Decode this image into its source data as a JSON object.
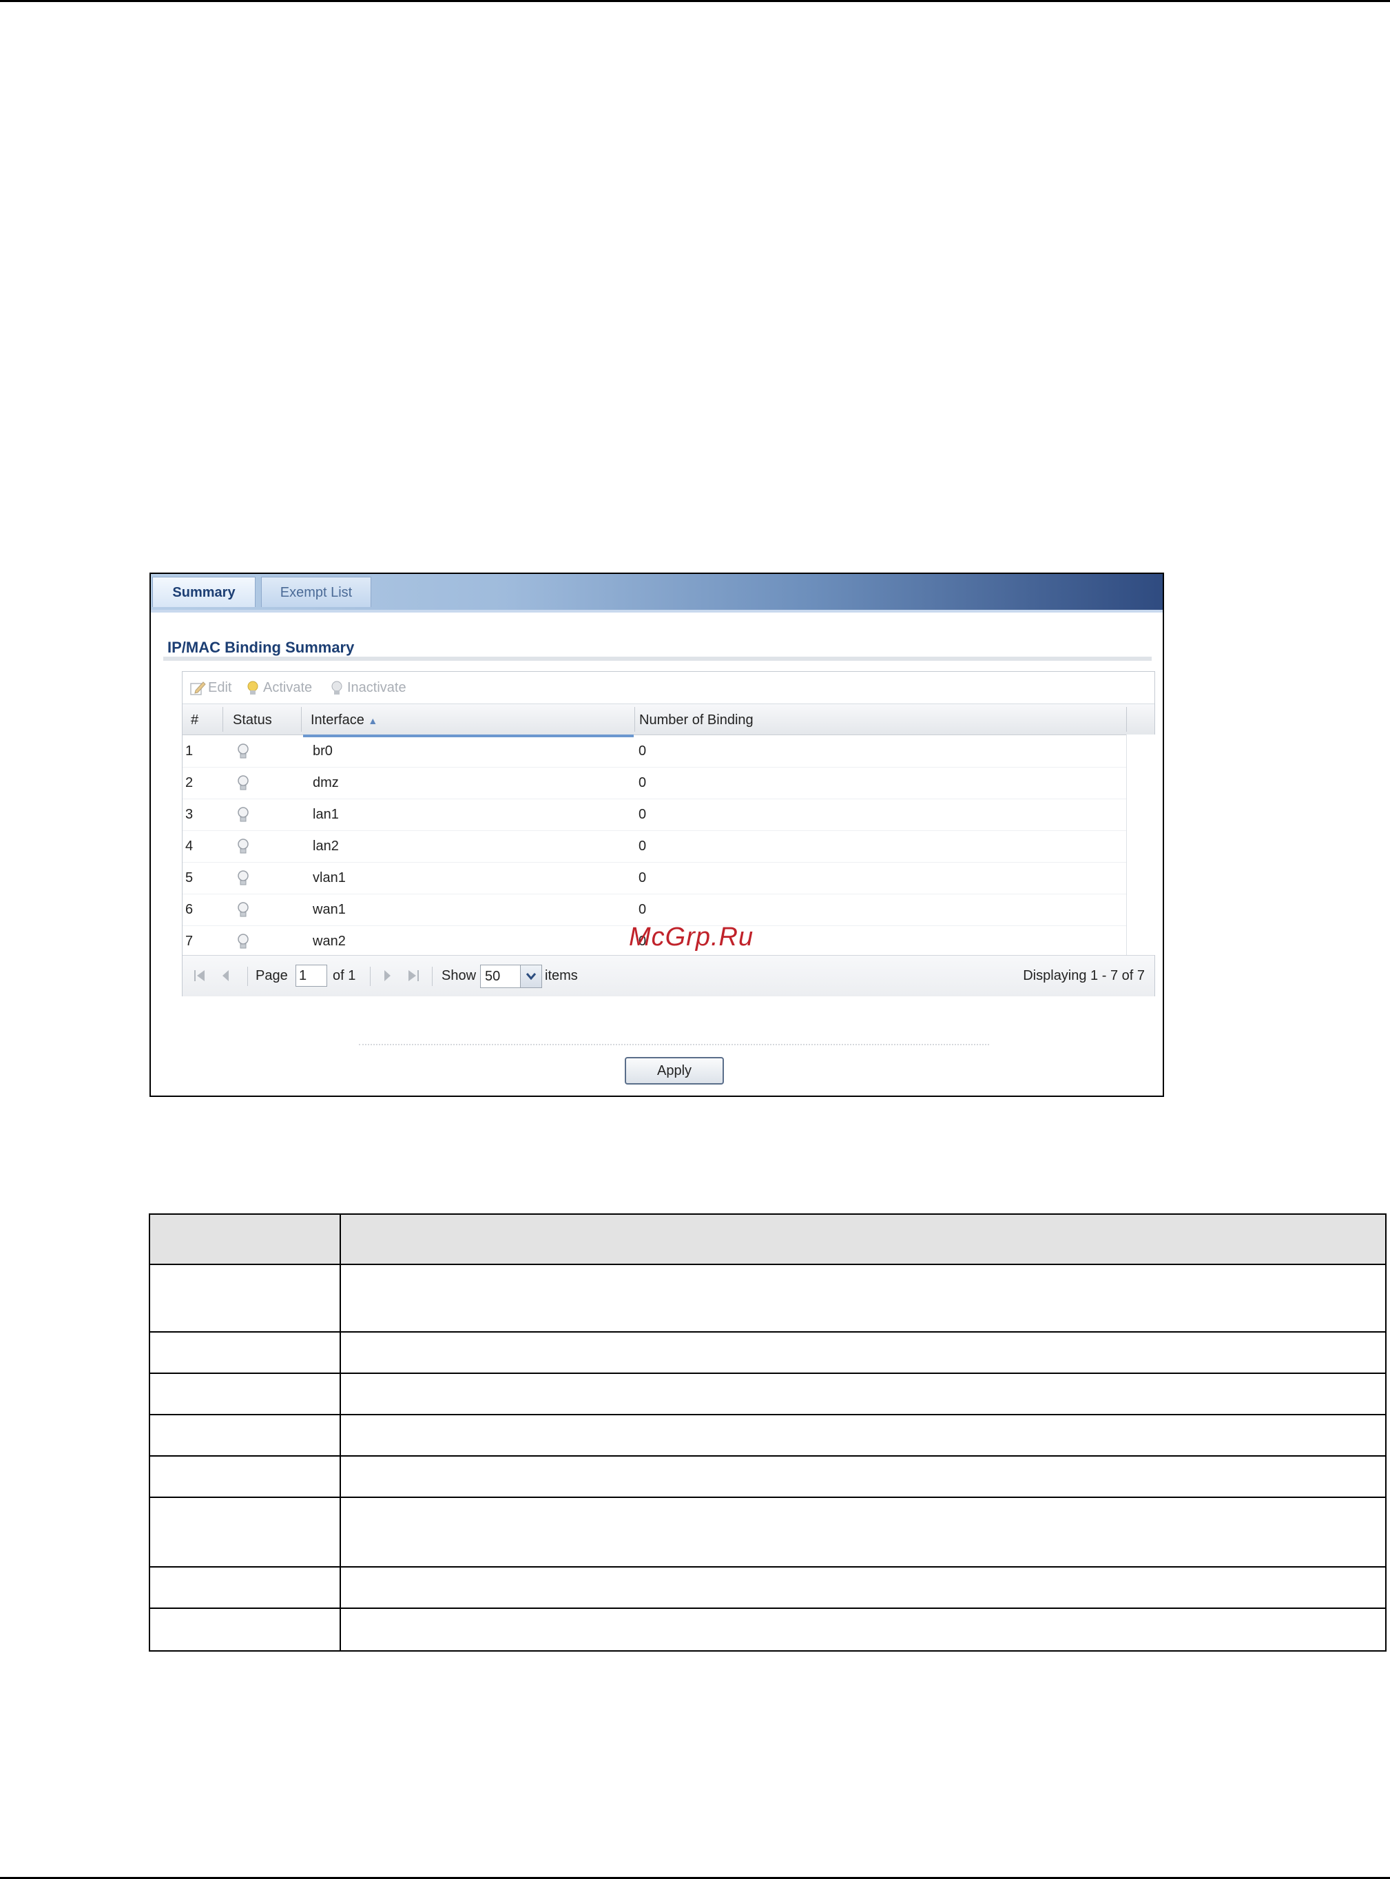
{
  "tabs": [
    {
      "label": "Summary",
      "active": true
    },
    {
      "label": "Exempt List",
      "active": false
    }
  ],
  "section_title": "IP/MAC Binding Summary",
  "toolbar": {
    "edit": "Edit",
    "activate": "Activate",
    "inactivate": "Inactivate"
  },
  "table": {
    "columns": [
      "#",
      "Status",
      "Interface",
      "Number of Binding"
    ],
    "sort_column": "Interface",
    "rows": [
      {
        "num": "1",
        "status": "inactive",
        "interface": "br0",
        "bindings": "0"
      },
      {
        "num": "2",
        "status": "inactive",
        "interface": "dmz",
        "bindings": "0"
      },
      {
        "num": "3",
        "status": "inactive",
        "interface": "lan1",
        "bindings": "0"
      },
      {
        "num": "4",
        "status": "inactive",
        "interface": "lan2",
        "bindings": "0"
      },
      {
        "num": "5",
        "status": "inactive",
        "interface": "vlan1",
        "bindings": "0"
      },
      {
        "num": "6",
        "status": "inactive",
        "interface": "wan1",
        "bindings": "0"
      },
      {
        "num": "7",
        "status": "inactive",
        "interface": "wan2",
        "bindings": "0"
      }
    ]
  },
  "pager": {
    "page_label": "Page",
    "page_value": "1",
    "of_label": "of 1",
    "show_label": "Show",
    "show_value": "50",
    "items_label": "items",
    "displaying": "Displaying 1 - 7 of 7"
  },
  "apply_label": "Apply",
  "watermark": "McGrp.Ru",
  "colors": {
    "accent": "#1c3e73",
    "sort_underline": "#6b97cf",
    "watermark": "#c0222a"
  }
}
